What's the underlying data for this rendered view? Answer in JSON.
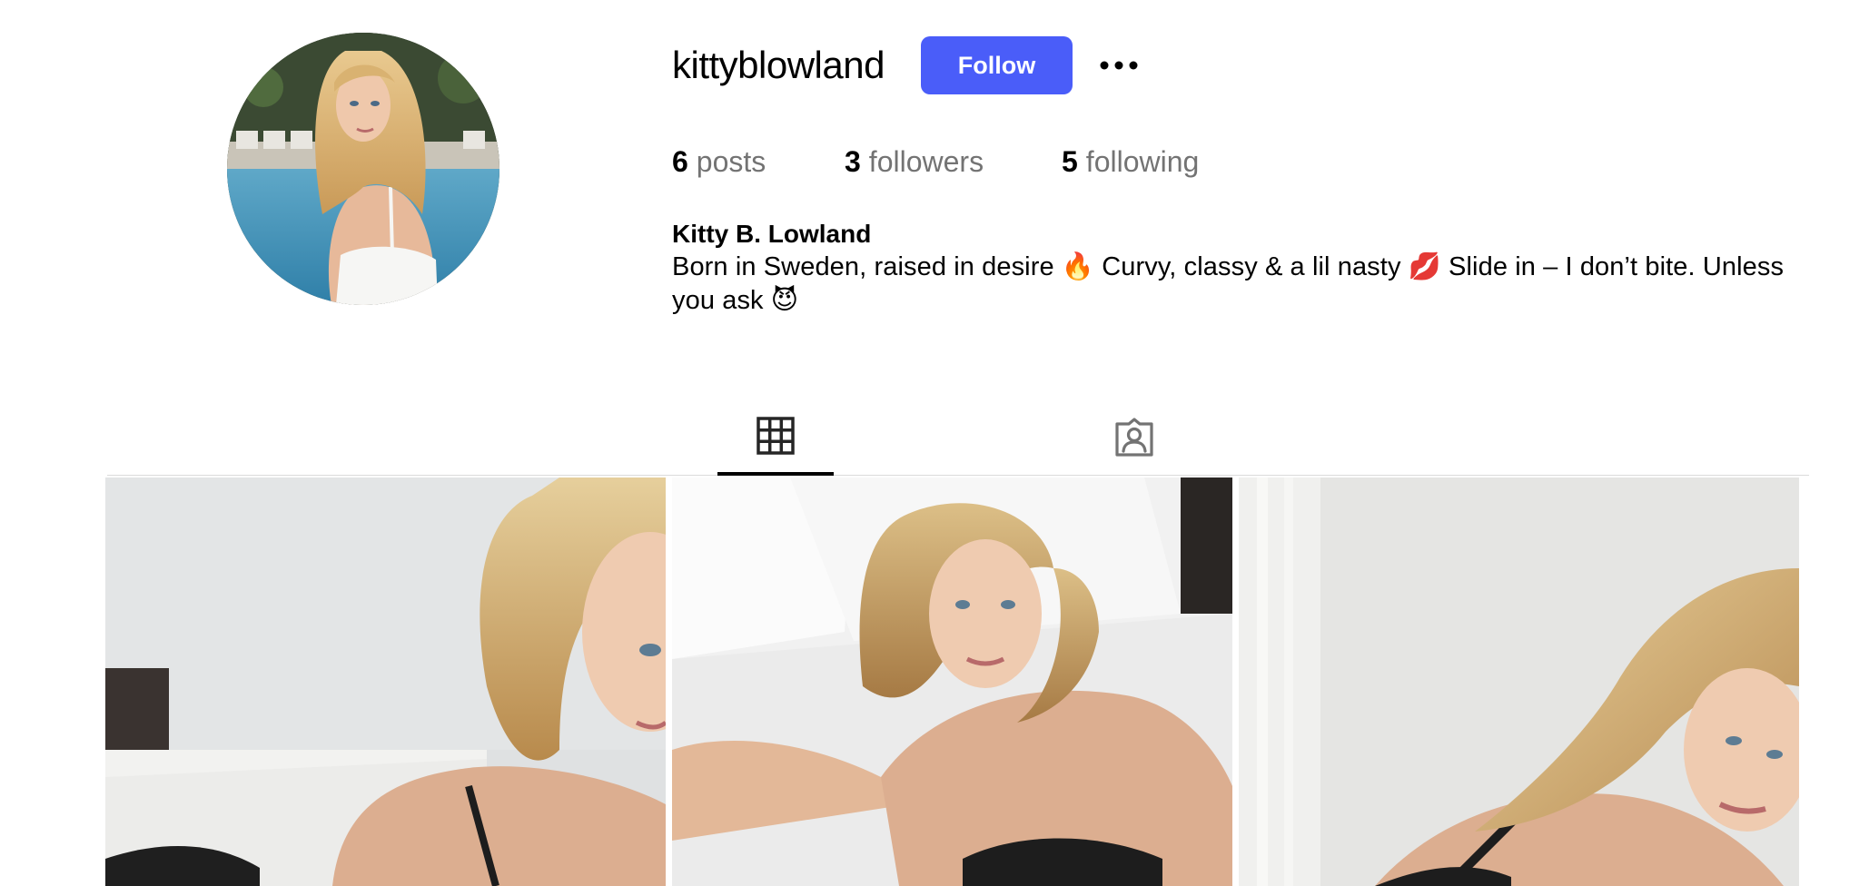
{
  "profile": {
    "username": "kittyblowland",
    "follow_label": "Follow",
    "more_icon": "more-horizontal-icon",
    "full_name": "Kitty B. Lowland",
    "bio": "Born in Sweden, raised in desire 🔥 Curvy, classy & a lil nasty 💋 Slide in – I don’t bite. Unless you ask 😈"
  },
  "stats": {
    "posts_count": "6",
    "posts_label": "posts",
    "followers_count": "3",
    "followers_label": "followers",
    "following_count": "5",
    "following_label": "following"
  },
  "tabs": [
    {
      "icon": "grid-icon",
      "selected": true
    },
    {
      "icon": "tagged-person-icon",
      "selected": false
    }
  ],
  "posts": [
    {
      "kind": "photo"
    },
    {
      "kind": "photo"
    },
    {
      "kind": "photo"
    }
  ],
  "colors": {
    "follow_button": "#4a5df9",
    "stat_label": "#737373",
    "tab_active_indicator": "#000000",
    "divider": "#dbdbdb"
  }
}
